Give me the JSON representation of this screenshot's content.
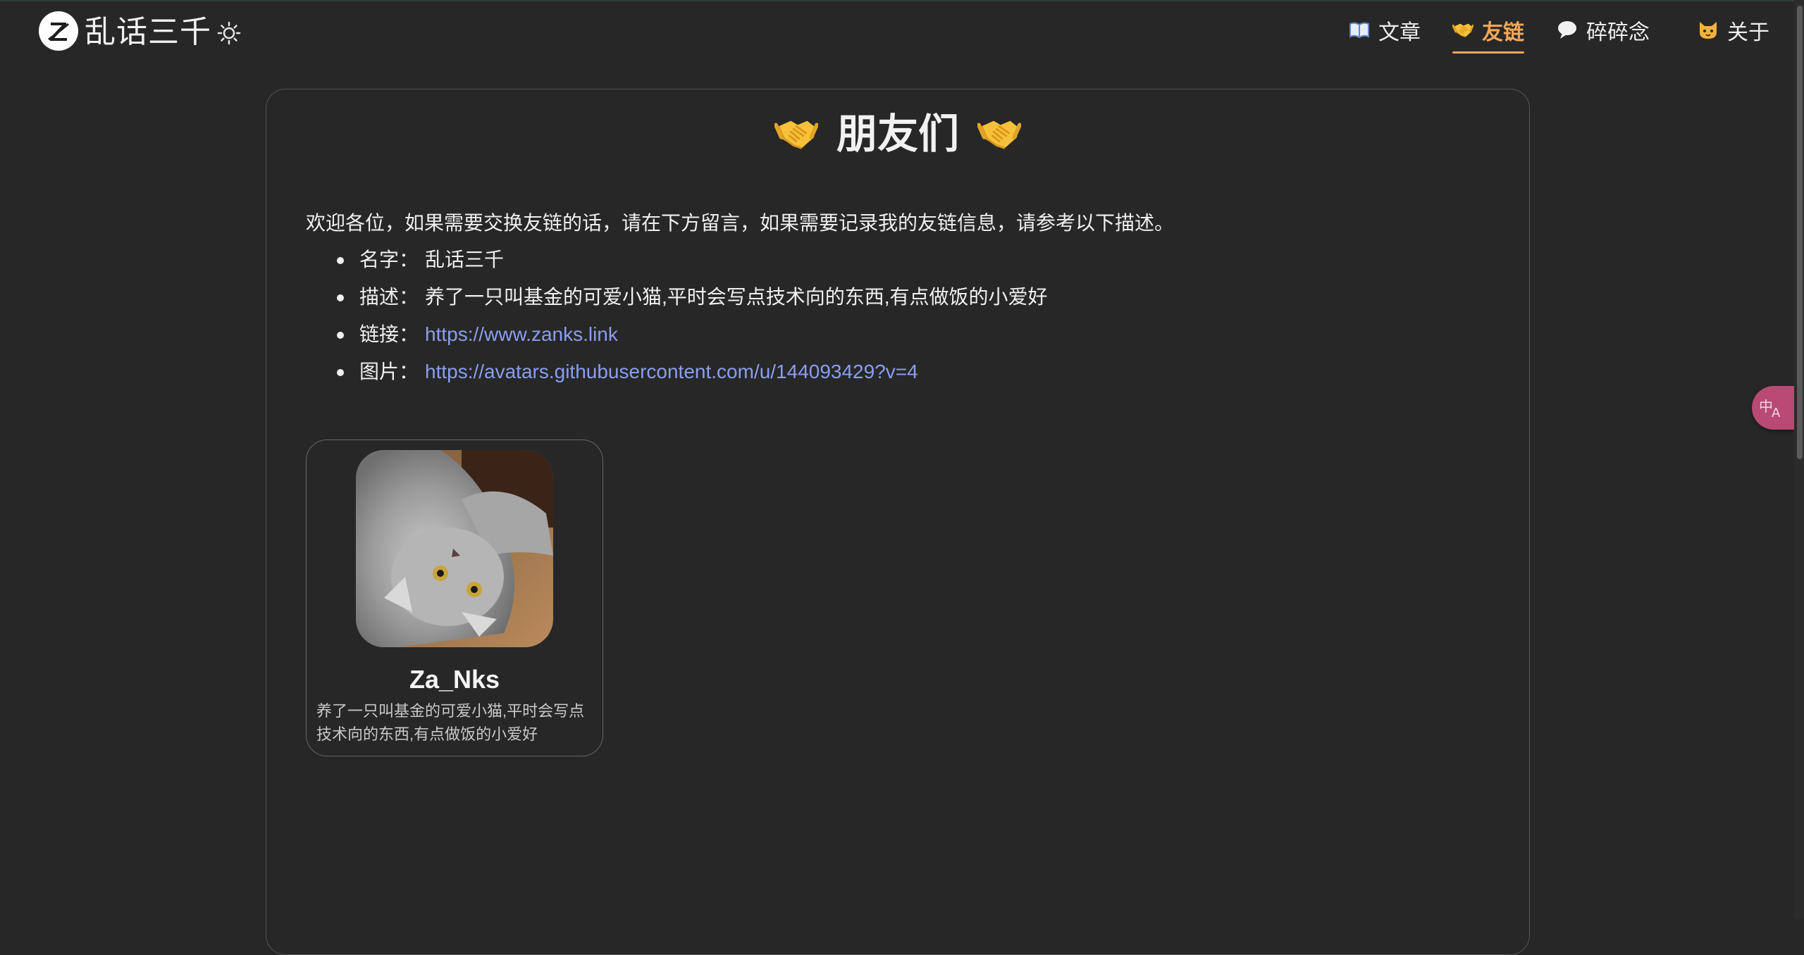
{
  "site": {
    "title": "乱话三千",
    "logo_icon": "z-logo-icon",
    "theme_icon": "sun-icon"
  },
  "nav": {
    "items": [
      {
        "label": "文章",
        "icon": "book-icon",
        "active": false
      },
      {
        "label": "友链",
        "icon": "handshake-icon",
        "active": true
      },
      {
        "label": "碎碎念",
        "icon": "speech-bubble-icon",
        "active": false
      },
      {
        "label": "关于",
        "icon": "cat-face-icon",
        "active": false
      }
    ]
  },
  "page": {
    "title": "朋友们",
    "title_icon": "handshake-icon",
    "intro": "欢迎各位，如果需要交换友链的话，请在下方留言，如果需要记录我的友链信息，请参考以下描述。",
    "info": [
      {
        "key": "名字：",
        "value": "乱话三千",
        "is_link": false
      },
      {
        "key": "描述：",
        "value": "养了一只叫基金的可爱小猫,平时会写点技术向的东西,有点做饭的小爱好",
        "is_link": false
      },
      {
        "key": "链接：",
        "value": "https://www.zanks.link",
        "is_link": true
      },
      {
        "key": "图片：",
        "value": "https://avatars.githubusercontent.com/u/144093429?v=4",
        "is_link": true
      }
    ]
  },
  "friends": [
    {
      "name": "Za_Nks",
      "description": "养了一只叫基金的可爱小猫,平时会写点技术向的东西,有点做饭的小爱好",
      "avatar": "gray-kitten-photo"
    }
  ],
  "colors": {
    "background": "#272727",
    "accent": "#f2a65a",
    "link": "#8a9ef0",
    "translate_button": "#b84a73"
  }
}
